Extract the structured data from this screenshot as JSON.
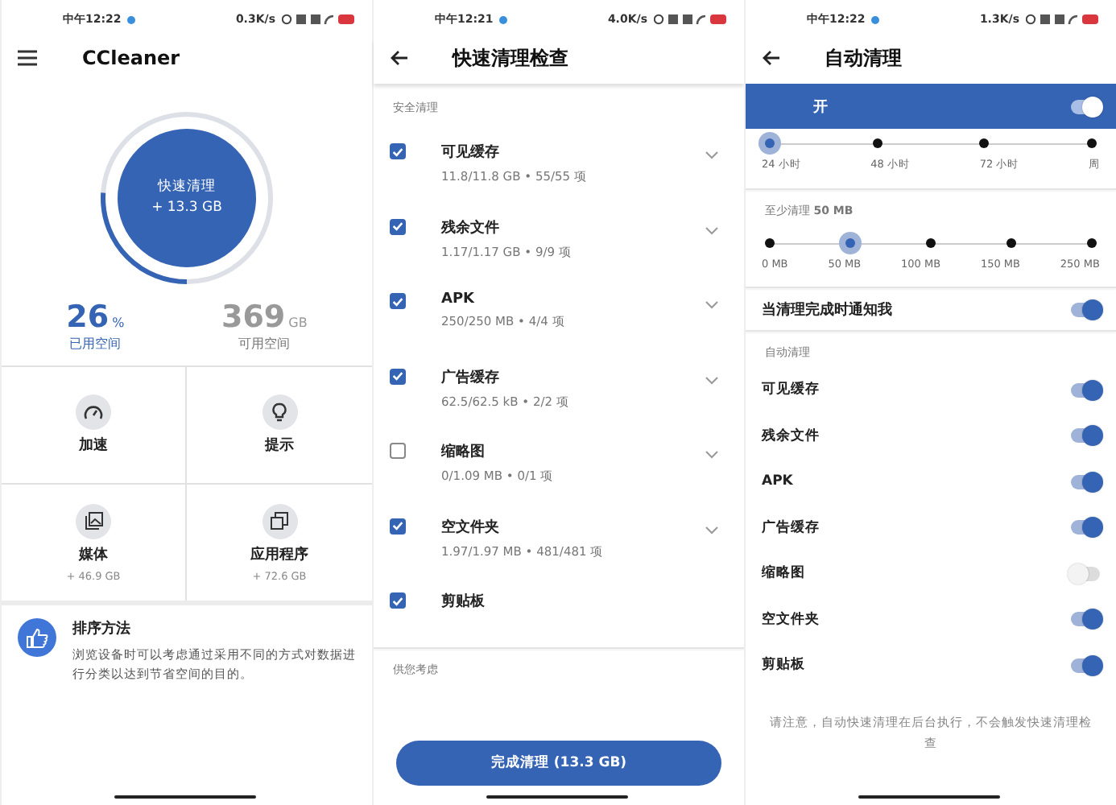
{
  "screens": [
    {
      "kind": "home",
      "status": {
        "time": "中午12:22",
        "speed": "0.3K/s"
      },
      "title": "CCleaner",
      "ring": {
        "level": 0.26,
        "label": "快速清理",
        "value": "+ 13.3 GB"
      },
      "stats": [
        {
          "value": "26",
          "unit": "%",
          "label": "已用空间",
          "kind": "used"
        },
        {
          "value": "369",
          "unit": "GB",
          "label": "可用空间",
          "kind": "free"
        }
      ],
      "tiles": [
        {
          "kind": "gauge",
          "label": "加速"
        },
        {
          "kind": "bulb",
          "label": "提示"
        },
        {
          "kind": "image",
          "label": "媒体",
          "sub": "+ 46.9 GB"
        },
        {
          "kind": "apps",
          "label": "应用程序",
          "sub": "+ 72.6 GB"
        }
      ],
      "tip": {
        "title": "排序方法",
        "text": "浏览设备时可以考虑通过采用不同的方式对数据进行分类以达到节省空间的目的。"
      }
    },
    {
      "kind": "review",
      "status": {
        "time": "中午12:21",
        "speed": "4.0K/s"
      },
      "title": "快速清理检查",
      "section": "安全清理",
      "items": [
        {
          "name": "可见缓存",
          "detail": "11.8/11.8 GB • 55/55 项",
          "checked": true,
          "expandable": true
        },
        {
          "name": "残余文件",
          "detail": "1.17/1.17 GB • 9/9 项",
          "checked": true,
          "expandable": true
        },
        {
          "name": "APK",
          "detail": "250/250 MB • 4/4 项",
          "checked": true,
          "expandable": true
        },
        {
          "name": "广告缓存",
          "detail": "62.5/62.5 kB • 2/2 项",
          "checked": true,
          "expandable": true
        },
        {
          "name": "缩略图",
          "detail": "0/1.09 MB • 0/1 项",
          "checked": false,
          "expandable": true
        },
        {
          "name": "空文件夹",
          "detail": "1.97/1.97 MB • 481/481 项",
          "checked": true,
          "expandable": true
        },
        {
          "name": "剪贴板",
          "checked": true,
          "expandable": false
        }
      ],
      "section2": "供您考虑",
      "button": "完成清理 (13.3 GB)"
    },
    {
      "kind": "auto",
      "status": {
        "time": "中午12:22",
        "speed": "1.3K/s"
      },
      "title": "自动清理",
      "master": {
        "label": "开",
        "on": true
      },
      "frequency": [
        {
          "label": "24 小时",
          "selected": true
        },
        {
          "label": "48 小时",
          "selected": false
        },
        {
          "label": "72 小时",
          "selected": false
        },
        {
          "label": "周",
          "selected": false
        }
      ],
      "min_label": "至少清理 **50 MB**",
      "minimum": [
        {
          "label": "0 MB",
          "selected": false
        },
        {
          "label": "50 MB",
          "selected": true
        },
        {
          "label": "100 MB",
          "selected": false
        },
        {
          "label": "150 MB",
          "selected": false
        },
        {
          "label": "250 MB",
          "selected": false
        }
      ],
      "notify": {
        "label": "当清理完成时通知我",
        "on": true
      },
      "section": "自动清理",
      "toggles": [
        {
          "label": "可见缓存",
          "on": true
        },
        {
          "label": "残余文件",
          "on": true
        },
        {
          "label": "APK",
          "on": true
        },
        {
          "label": "广告缓存",
          "on": true
        },
        {
          "label": "缩略图",
          "on": false
        },
        {
          "label": "空文件夹",
          "on": true
        },
        {
          "label": "剪贴板",
          "on": true
        }
      ],
      "note": "请注意，自动快速清理在后台执行，不会触发快速清理检查"
    }
  ]
}
